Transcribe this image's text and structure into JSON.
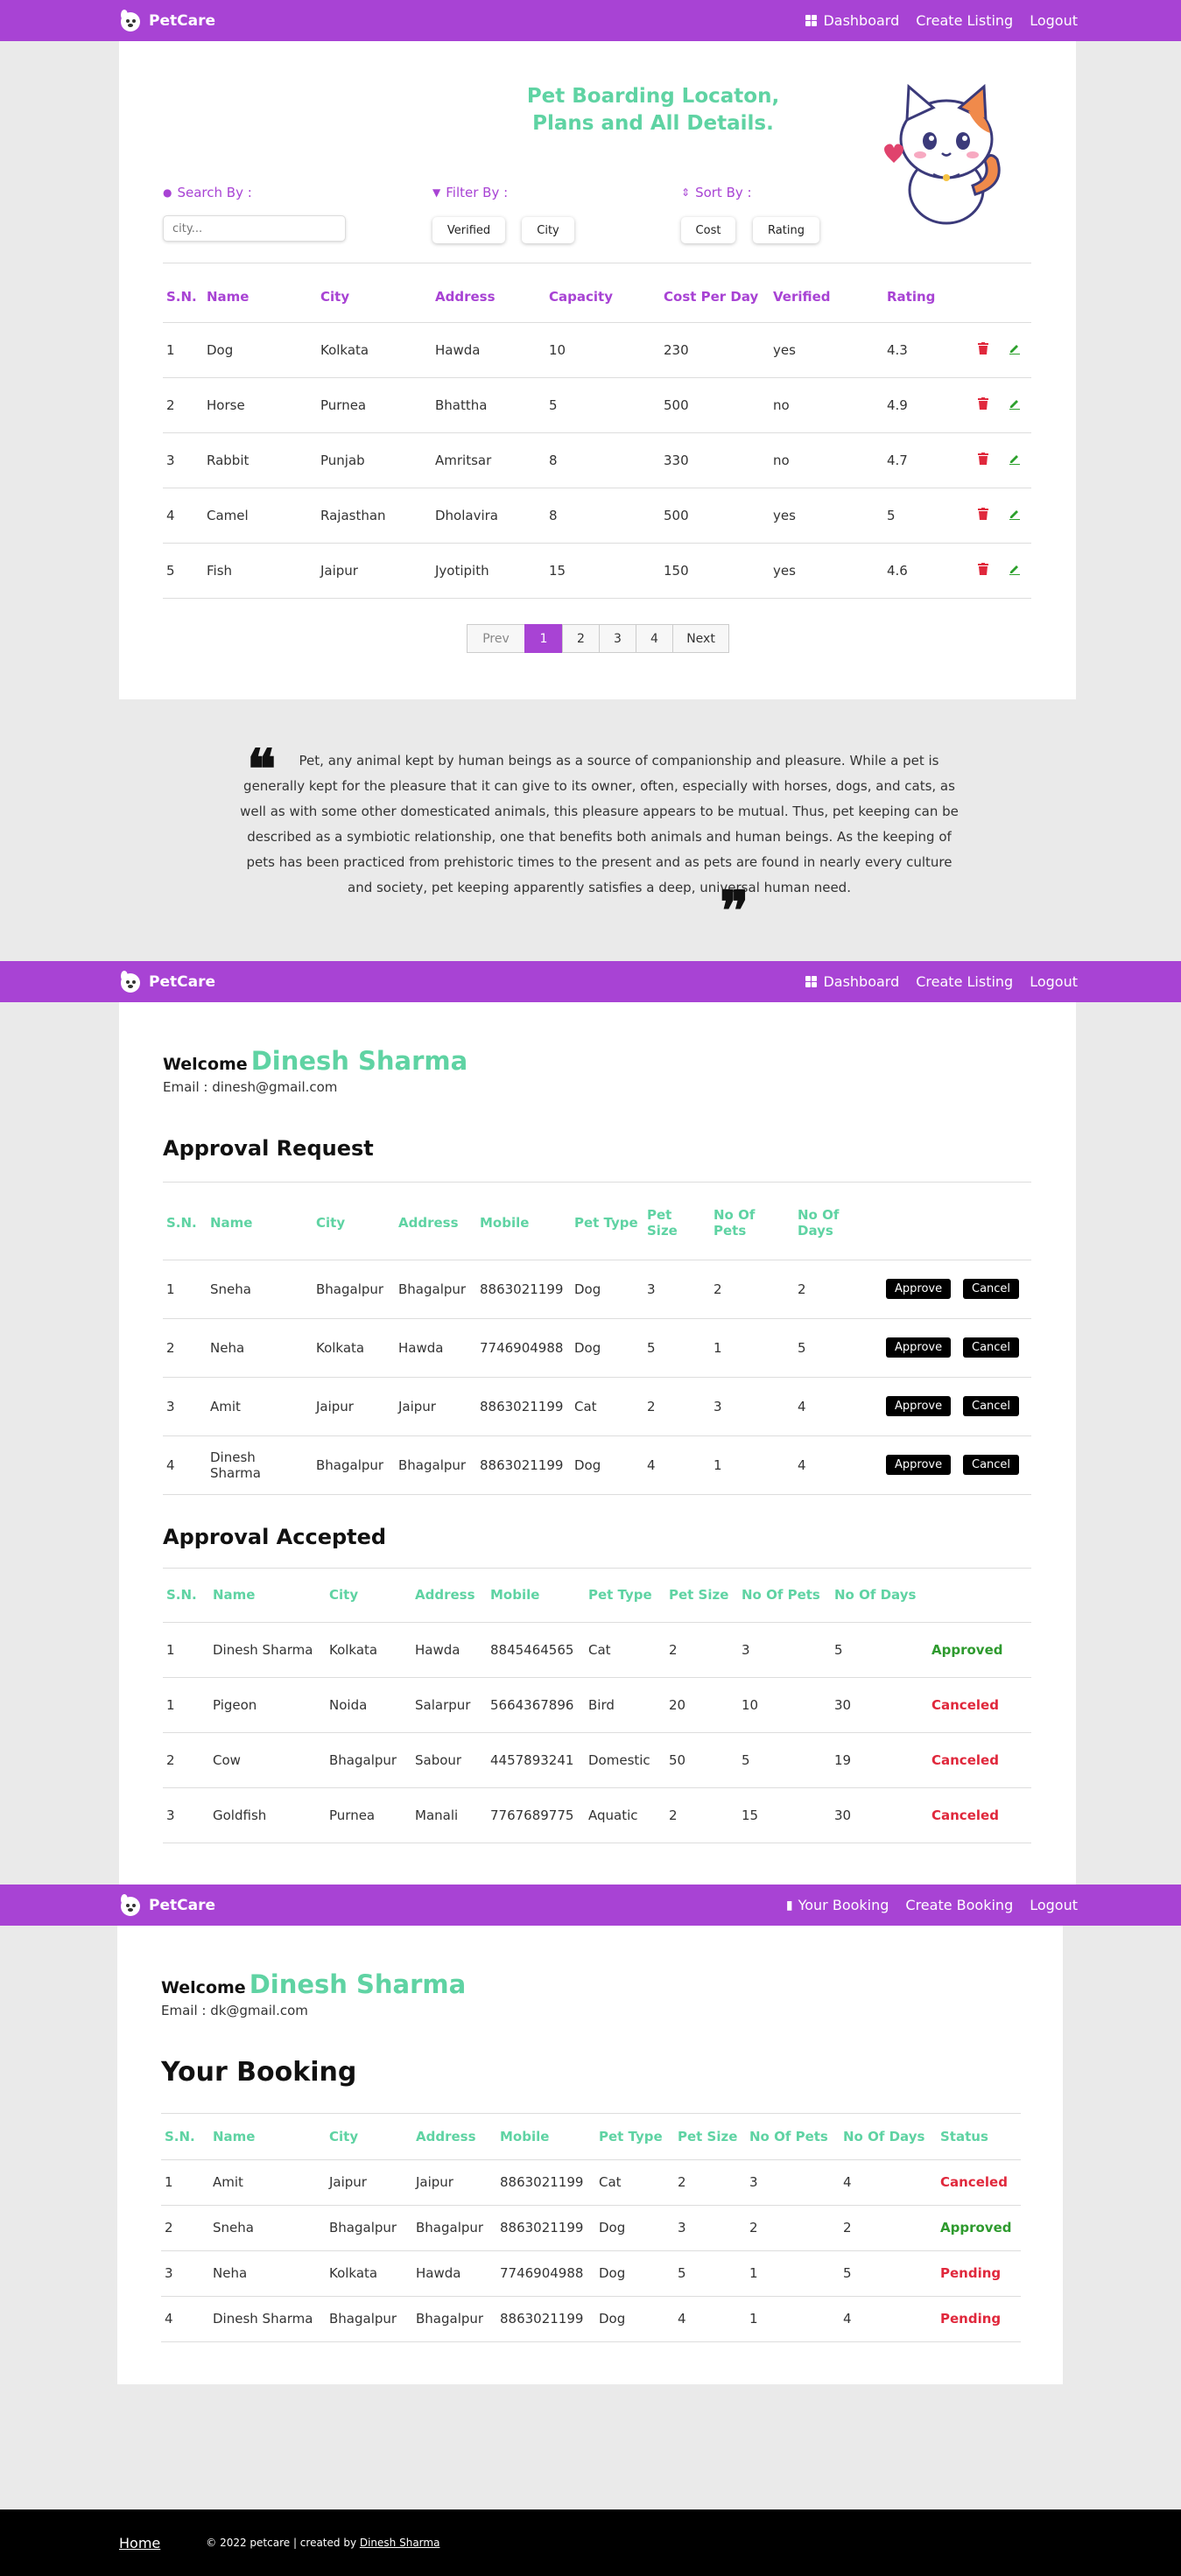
{
  "brand": "PetCare",
  "nav1": {
    "links": [
      "Dashboard",
      "Create Listing",
      "Logout"
    ]
  },
  "nav2": {
    "links": [
      "Dashboard",
      "Create Listing",
      "Logout"
    ]
  },
  "nav3": {
    "links": [
      "Your Booking",
      "Create Booking",
      "Logout"
    ]
  },
  "listing": {
    "title": "Pet Boarding Locaton, Plans and All Details.",
    "search_label": "Search By :",
    "search_placeholder": "city...",
    "filter_label": "Filter By :",
    "filter_options": [
      "Verified",
      "City"
    ],
    "sort_label": "Sort By :",
    "sort_options": [
      "Cost",
      "Rating"
    ],
    "columns": [
      "S.N.",
      "Name",
      "City",
      "Address",
      "Capacity",
      "Cost Per Day",
      "Verified",
      "Rating"
    ],
    "rows": [
      [
        "1",
        "Dog",
        "Kolkata",
        "Hawda",
        "10",
        "230",
        "yes",
        "4.3"
      ],
      [
        "2",
        "Horse",
        "Purnea",
        "Bhattha",
        "5",
        "500",
        "no",
        "4.9"
      ],
      [
        "3",
        "Rabbit",
        "Punjab",
        "Amritsar",
        "8",
        "330",
        "no",
        "4.7"
      ],
      [
        "4",
        "Camel",
        "Rajasthan",
        "Dholavira",
        "8",
        "500",
        "yes",
        "5"
      ],
      [
        "5",
        "Fish",
        "Jaipur",
        "Jyotipith",
        "15",
        "150",
        "yes",
        "4.6"
      ]
    ],
    "pager": {
      "prev": "Prev",
      "pages": [
        "1",
        "2",
        "3",
        "4"
      ],
      "next": "Next",
      "active": "1"
    }
  },
  "quote": "Pet, any animal kept by human beings as a source of companionship and pleasure. While a pet is generally kept for the pleasure that it can give to its owner, often, especially with horses, dogs, and cats, as well as with some other domesticated animals, this pleasure appears to be mutual. Thus, pet keeping can be described as a symbiotic relationship, one that benefits both animals and human beings. As the keeping of pets has been practiced from prehistoric times to the present and as pets are found in nearly every culture and society, pet keeping apparently satisfies a deep, universal human need.",
  "host": {
    "welcome": "Welcome",
    "name": "Dinesh Sharma",
    "email": "Email : dinesh@gmail.com",
    "request_title": "Approval Request",
    "request_columns": [
      "S.N.",
      "Name",
      "City",
      "Address",
      "Mobile",
      "Pet Type",
      "Pet Size",
      "No Of Pets",
      "No Of Days"
    ],
    "request_rows": [
      [
        "1",
        "Sneha",
        "Bhagalpur",
        "Bhagalpur",
        "8863021199",
        "Dog",
        "3",
        "2",
        "2"
      ],
      [
        "2",
        "Neha",
        "Kolkata",
        "Hawda",
        "7746904988",
        "Dog",
        "5",
        "1",
        "5"
      ],
      [
        "3",
        "Amit",
        "Jaipur",
        "Jaipur",
        "8863021199",
        "Cat",
        "2",
        "3",
        "4"
      ],
      [
        "4",
        "Dinesh Sharma",
        "Bhagalpur",
        "Bhagalpur",
        "8863021199",
        "Dog",
        "4",
        "1",
        "4"
      ]
    ],
    "approve_label": "Approve",
    "cancel_label": "Cancel",
    "accepted_title": "Approval Accepted",
    "accepted_columns": [
      "S.N.",
      "Name",
      "City",
      "Address",
      "Mobile",
      "Pet Type",
      "Pet Size",
      "No Of Pets",
      "No Of Days"
    ],
    "accepted_rows": [
      [
        "1",
        "Dinesh Sharma",
        "Kolkata",
        "Hawda",
        "8845464565",
        "Cat",
        "2",
        "3",
        "5",
        "Approved"
      ],
      [
        "1",
        "Pigeon",
        "Noida",
        "Salarpur",
        "5664367896",
        "Bird",
        "20",
        "10",
        "30",
        "Canceled"
      ],
      [
        "2",
        "Cow",
        "Bhagalpur",
        "Sabour",
        "4457893241",
        "Domestic",
        "50",
        "5",
        "19",
        "Canceled"
      ],
      [
        "3",
        "Goldfish",
        "Purnea",
        "Manali",
        "7767689775",
        "Aquatic",
        "2",
        "15",
        "30",
        "Canceled"
      ]
    ]
  },
  "user": {
    "welcome": "Welcome",
    "name": "Dinesh Sharma",
    "email": "Email : dk@gmail.com",
    "title": "Your Booking",
    "columns": [
      "S.N.",
      "Name",
      "City",
      "Address",
      "Mobile",
      "Pet Type",
      "Pet Size",
      "No Of Pets",
      "No Of Days",
      "Status"
    ],
    "rows": [
      [
        "1",
        "Amit",
        "Jaipur",
        "Jaipur",
        "8863021199",
        "Cat",
        "2",
        "3",
        "4",
        "Canceled"
      ],
      [
        "2",
        "Sneha",
        "Bhagalpur",
        "Bhagalpur",
        "8863021199",
        "Dog",
        "3",
        "2",
        "2",
        "Approved"
      ],
      [
        "3",
        "Neha",
        "Kolkata",
        "Hawda",
        "7746904988",
        "Dog",
        "5",
        "1",
        "5",
        "Pending"
      ],
      [
        "4",
        "Dinesh Sharma",
        "Bhagalpur",
        "Bhagalpur",
        "8863021199",
        "Dog",
        "4",
        "1",
        "4",
        "Pending"
      ]
    ]
  },
  "footer": {
    "home": "Home",
    "copy_prefix": "© 2022 petcare | created by ",
    "author": "Dinesh Sharma"
  },
  "colors": {
    "nav": "#a843d4",
    "accent": "#5fd3a3",
    "approved": "#2e9a2e",
    "canceled": "#e0283c"
  },
  "icons": {
    "delete": "trash-icon",
    "edit": "pencil-icon",
    "search": "search-icon",
    "filter": "filter-icon",
    "sort": "sort-icon",
    "dashboard": "grid-icon",
    "booking": "bookmark-icon",
    "quote": "quote-icon"
  }
}
